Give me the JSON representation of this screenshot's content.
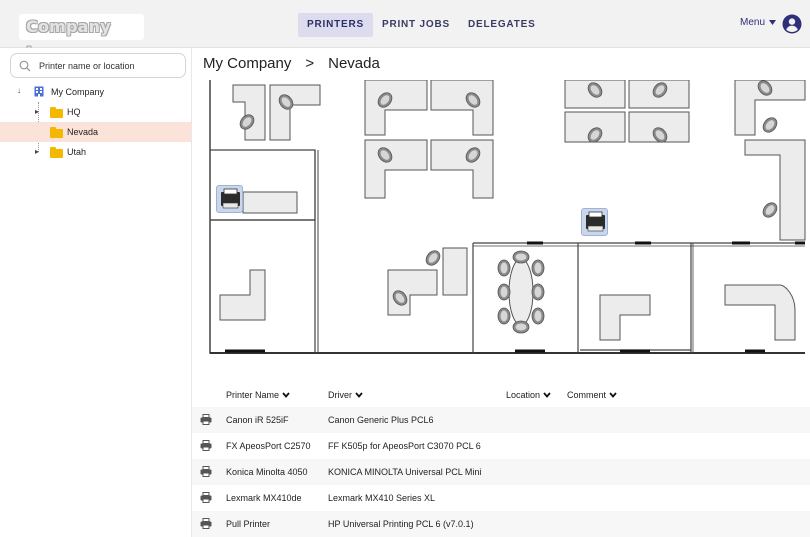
{
  "header": {
    "logo_text": "Company Logo",
    "tabs": [
      {
        "label": "PRINTERS",
        "active": true
      },
      {
        "label": "PRINT JOBS",
        "active": false
      },
      {
        "label": "DELEGATES",
        "active": false
      }
    ],
    "menu_label": "Menu",
    "menu_icon": "caret-down-icon",
    "user_icon": "account-circle-icon"
  },
  "sidebar": {
    "search": {
      "placeholder": "Printer name or location",
      "value": ""
    },
    "tree": {
      "root": {
        "label": "My Company",
        "icon": "building-icon",
        "expanded": true
      },
      "children": [
        {
          "label": "HQ",
          "icon": "folder-icon",
          "expanded": false,
          "selected": false
        },
        {
          "label": "Nevada",
          "icon": "folder-icon",
          "expanded": false,
          "selected": true
        },
        {
          "label": "Utah",
          "icon": "folder-icon",
          "expanded": false,
          "selected": false
        }
      ]
    }
  },
  "breadcrumb": {
    "items": [
      "My Company",
      "Nevada"
    ],
    "separator": ">"
  },
  "table": {
    "columns": [
      "Printer Name",
      "Driver",
      "Location",
      "Comment"
    ],
    "rows": [
      {
        "name": "Canon iR 525iF",
        "driver": "Canon Generic Plus PCL6",
        "location": "",
        "comment": ""
      },
      {
        "name": "FX ApeosPort C2570",
        "driver": "FF K505p for ApeosPort C3070 PCL 6",
        "location": "",
        "comment": ""
      },
      {
        "name": "Konica Minolta 4050",
        "driver": "KONICA MINOLTA Universal PCL Mini",
        "location": "",
        "comment": ""
      },
      {
        "name": "Lexmark MX410de",
        "driver": "Lexmark MX410 Series XL",
        "location": "",
        "comment": ""
      },
      {
        "name": "Pull Printer",
        "driver": "HP Universal Printing PCL 6 (v7.0.1)",
        "location": "",
        "comment": ""
      }
    ]
  },
  "colors": {
    "accent": "#2f2f7a",
    "selected_row": "#fbe3d9",
    "folder": "#f5b800",
    "marker": "#c9d6ec"
  }
}
